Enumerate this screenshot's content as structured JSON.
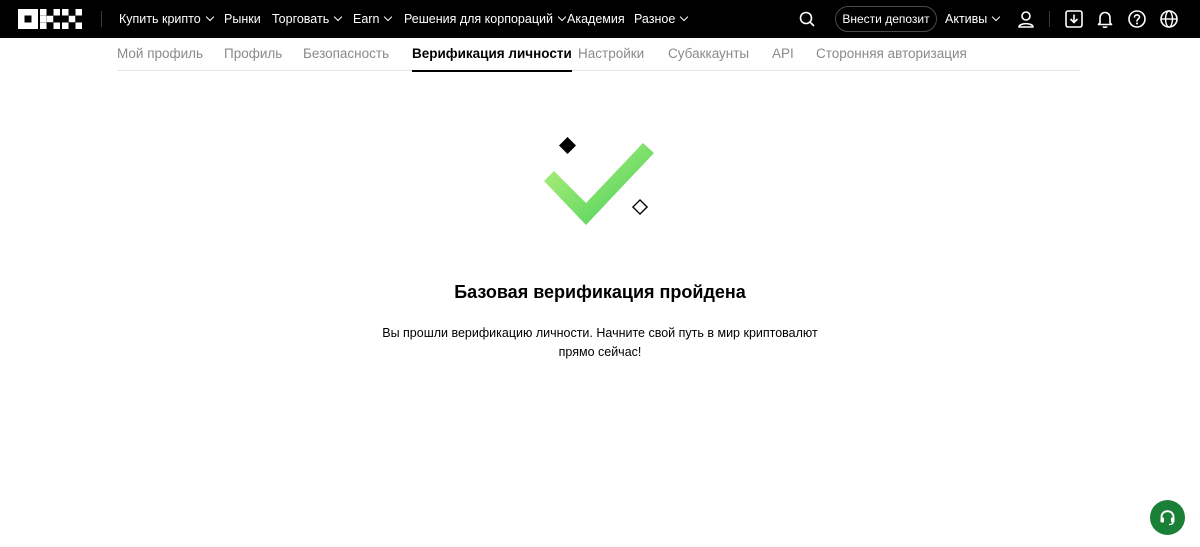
{
  "brand": {
    "logo_icon": "okx-logo-icon"
  },
  "topnav": {
    "items": [
      {
        "label": "Купить крипто",
        "has_dropdown": true
      },
      {
        "label": "Рынки",
        "has_dropdown": false
      },
      {
        "label": "Торговать",
        "has_dropdown": true
      },
      {
        "label": "Earn",
        "has_dropdown": true
      },
      {
        "label": "Решения для корпораций",
        "has_dropdown": true
      },
      {
        "label": "Академия",
        "has_dropdown": false
      },
      {
        "label": "Разное",
        "has_dropdown": true
      }
    ],
    "deposit_label": "Внести депозит",
    "assets_label": "Активы",
    "icons": [
      "search-icon",
      "user-icon",
      "download-icon",
      "bell-icon",
      "help-icon",
      "globe-icon"
    ]
  },
  "tabs": [
    {
      "label": "Мой профиль",
      "active": false
    },
    {
      "label": "Профиль",
      "active": false
    },
    {
      "label": "Безопасность",
      "active": false
    },
    {
      "label": "Верификация личности",
      "active": true
    },
    {
      "label": "Настройки",
      "active": false
    },
    {
      "label": "Субаккаунты",
      "active": false
    },
    {
      "label": "API",
      "active": false
    },
    {
      "label": "Сторонняя авторизация",
      "active": false
    }
  ],
  "success": {
    "icon": "checkmark-success-icon",
    "title": "Базовая верификация пройдена",
    "description_line1": "Вы прошли верификацию личности. Начните свой путь в мир криптовалют",
    "description_line2": "прямо сейчас!"
  },
  "support": {
    "icon": "headset-icon"
  },
  "colors": {
    "topbar_bg": "#000000",
    "accent_green": "#5fd35f",
    "support_bg": "#1a7f37"
  }
}
